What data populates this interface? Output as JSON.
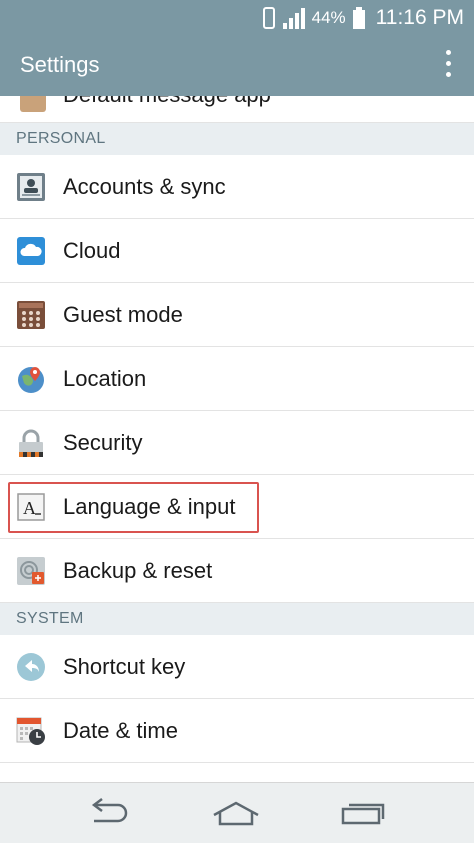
{
  "status": {
    "battery": "44%",
    "time": "11:16 PM"
  },
  "actionbar": {
    "title": "Settings"
  },
  "partial_item": {
    "label": "Default message app"
  },
  "sections": {
    "personal": "PERSONAL",
    "system": "SYSTEM"
  },
  "items": {
    "accounts": "Accounts & sync",
    "cloud": "Cloud",
    "guest": "Guest mode",
    "location": "Location",
    "security": "Security",
    "language": "Language & input",
    "backup": "Backup & reset",
    "shortcut": "Shortcut key",
    "datetime": "Date & time"
  },
  "icons": {
    "accounts": "accounts-icon",
    "cloud": "cloud-icon",
    "guest": "guest-mode-icon",
    "location": "location-icon",
    "security": "lock-icon",
    "language": "language-icon",
    "backup": "backup-icon",
    "shortcut": "shortcut-icon",
    "datetime": "calendar-clock-icon"
  },
  "colors": {
    "header": "#7b98a3",
    "section_bg": "#e9eef1",
    "highlight": "#d9534f"
  }
}
